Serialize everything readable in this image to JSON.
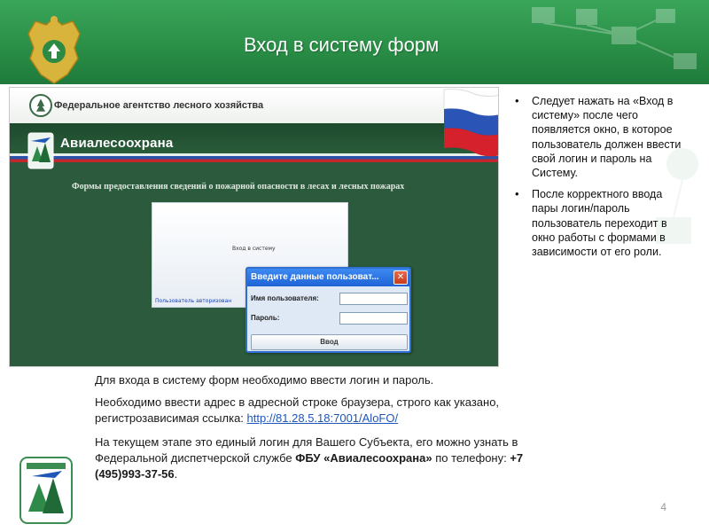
{
  "slide": {
    "title": "Вход в систему форм",
    "page_number": "4",
    "colors": {
      "header_green": "#2a8f47",
      "screenshot_green": "#2b5a3c",
      "link_blue": "#1f56b8",
      "dialog_blue": "#2f6fd3"
    }
  },
  "screenshot": {
    "agency_name": "Федеральное агентство лесного хозяйства",
    "brand_name": "Авиалесоохрана",
    "form_title": "Формы предоставления сведений о пожарной опасности в лесах и лесных пожарах",
    "login_link": "Вход в систему",
    "auth_user": "Пользователь авторизован",
    "dialog": {
      "title": "Введите данные пользоват...",
      "close_glyph": "✕",
      "username_label": "Имя пользователя:",
      "password_label": "Пароль:",
      "submit_label": "Ввод",
      "username_value": "",
      "password_value": ""
    }
  },
  "bullets": [
    "Следует нажать на «Вход в систему» после чего появляется окно, в которое пользователь должен ввести свой логин и пароль на Систему.",
    "После корректного ввода пары логин/пароль пользователь переходит в окно работы с формами в зависимости от его роли."
  ],
  "body": {
    "p1": "Для входа в систему форм необходимо ввести логин и пароль.",
    "p2_a": "Необходимо ввести адрес в адресной строке браузера, строго как указано, регистрозависимая ссылка: ",
    "p2_link": "http://81.28.5.18:7001/AloFO/",
    "p3_a": "На текущем этапе это единый логин для Вашего Субъекта, его можно узнать в Федеральной диспетчерской службе ",
    "p3_org": "ФБУ «Авиалесоохрана»",
    "p3_b": " по телефону: ",
    "p3_phone": "+7 (495)993-37-56",
    "p3_end": "."
  }
}
